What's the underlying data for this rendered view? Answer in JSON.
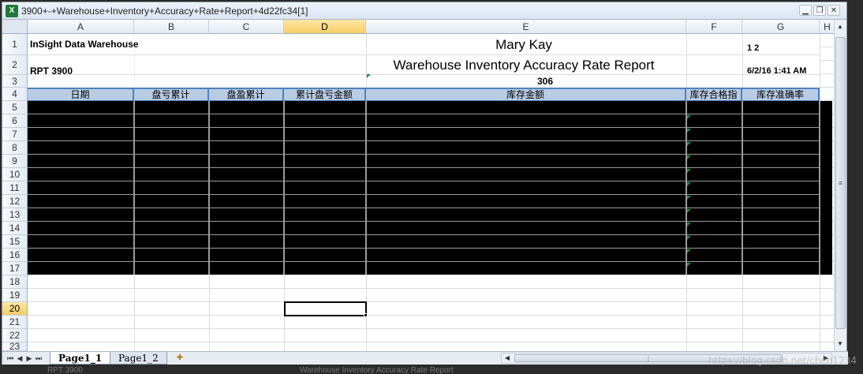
{
  "window": {
    "title": "3900+-+Warehouse+Inventory+Accuracy+Rate+Report+4d22fc34[1]",
    "icon": "excel-icon",
    "buttons": [
      "minimize",
      "restore",
      "close"
    ]
  },
  "columns": [
    "A",
    "B",
    "C",
    "D",
    "E",
    "F",
    "G",
    "H"
  ],
  "selected_column": "D",
  "rows": [
    "1",
    "2",
    "3",
    "4",
    "5",
    "6",
    "7",
    "8",
    "9",
    "10",
    "11",
    "12",
    "13",
    "14",
    "15",
    "16",
    "17",
    "18",
    "19",
    "20",
    "21",
    "22",
    "23"
  ],
  "selected_row": "20",
  "sheet": {
    "company": "InSight Data Warehouse",
    "brand": "Mary Kay",
    "page_numbers": "1  2",
    "report_code": "RPT 3900",
    "report_title": "Warehouse Inventory Accuracy Rate Report",
    "timestamp": "6/2/16 1:41 AM",
    "report_number": "306",
    "table_headers": [
      "日期",
      "盘亏累计",
      "盘盈累计",
      "累计盘亏金额",
      "库存金额",
      "库存合格指标",
      "库存准确率"
    ]
  },
  "tabs": {
    "active": "Page1_1",
    "inactive": "Page1_2"
  },
  "watermark": "https://blog.csdn.net/chen1234",
  "behind_window_text": {
    "left": "RPT 3900",
    "center": "Warehouse Inventory Accuracy Rate Report"
  },
  "colors": {
    "header_fill": "#b8cce4",
    "header_border": "#4f81bd",
    "data_fill": "#000000",
    "selected_header": "#f7cd64"
  }
}
